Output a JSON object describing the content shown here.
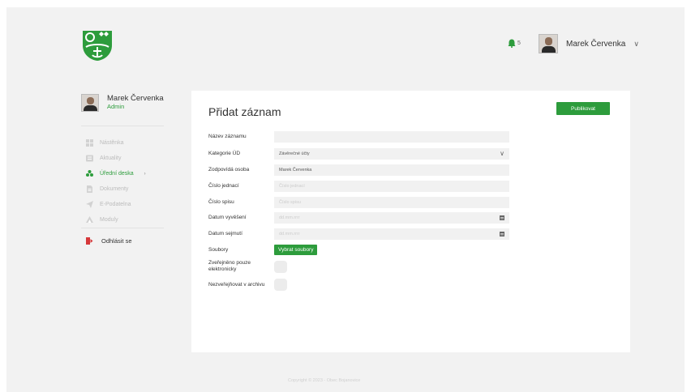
{
  "header": {
    "notification_count": "5",
    "user_name": "Marek Červenka"
  },
  "sidebar": {
    "user_name": "Marek Červenka",
    "user_role": "Admin",
    "items": [
      {
        "label": "Nástěnka",
        "icon": "grid-icon",
        "active": false
      },
      {
        "label": "Aktuality",
        "icon": "news-icon",
        "active": false
      },
      {
        "label": "Úřední deska",
        "icon": "tree-icon",
        "active": true
      },
      {
        "label": "Dokumenty",
        "icon": "document-icon",
        "active": false
      },
      {
        "label": "E-Podatelna",
        "icon": "send-icon",
        "active": false
      },
      {
        "label": "Moduly",
        "icon": "modules-icon",
        "active": false
      }
    ],
    "logout_label": "Odhlásit se"
  },
  "form": {
    "title": "Přidat záznam",
    "publish_label": "Publikovat",
    "fields": {
      "name": {
        "label": "Název záznamu",
        "value": ""
      },
      "category": {
        "label": "Kategorie ÚD",
        "value": "Závěrečné účty"
      },
      "responsible": {
        "label": "Zodpovídá osoba",
        "value": "Marek Červenka"
      },
      "reference": {
        "label": "Číslo jednací",
        "placeholder": "Číslo jednací"
      },
      "file_no": {
        "label": "Číslo spisu",
        "placeholder": "Číslo spisu"
      },
      "posted": {
        "label": "Datum vyvěšení",
        "placeholder": "dd.mm.rrrr"
      },
      "removed": {
        "label": "Datum sejmutí",
        "placeholder": "dd.mm.rrrr"
      },
      "files": {
        "label": "Soubory",
        "button": "Vybrat soubory"
      },
      "electronic_only": {
        "label": "Zveřejněno pouze elektronicky"
      },
      "no_archive": {
        "label": "Nezveřejňovat v archivu"
      }
    }
  },
  "footer": {
    "copyright": "Copyright © 2023 - Obec Bojanovice"
  },
  "colors": {
    "accent": "#2d9c3c",
    "background": "#f2f2f2",
    "card": "#ffffff",
    "field": "#f1f1f1"
  }
}
